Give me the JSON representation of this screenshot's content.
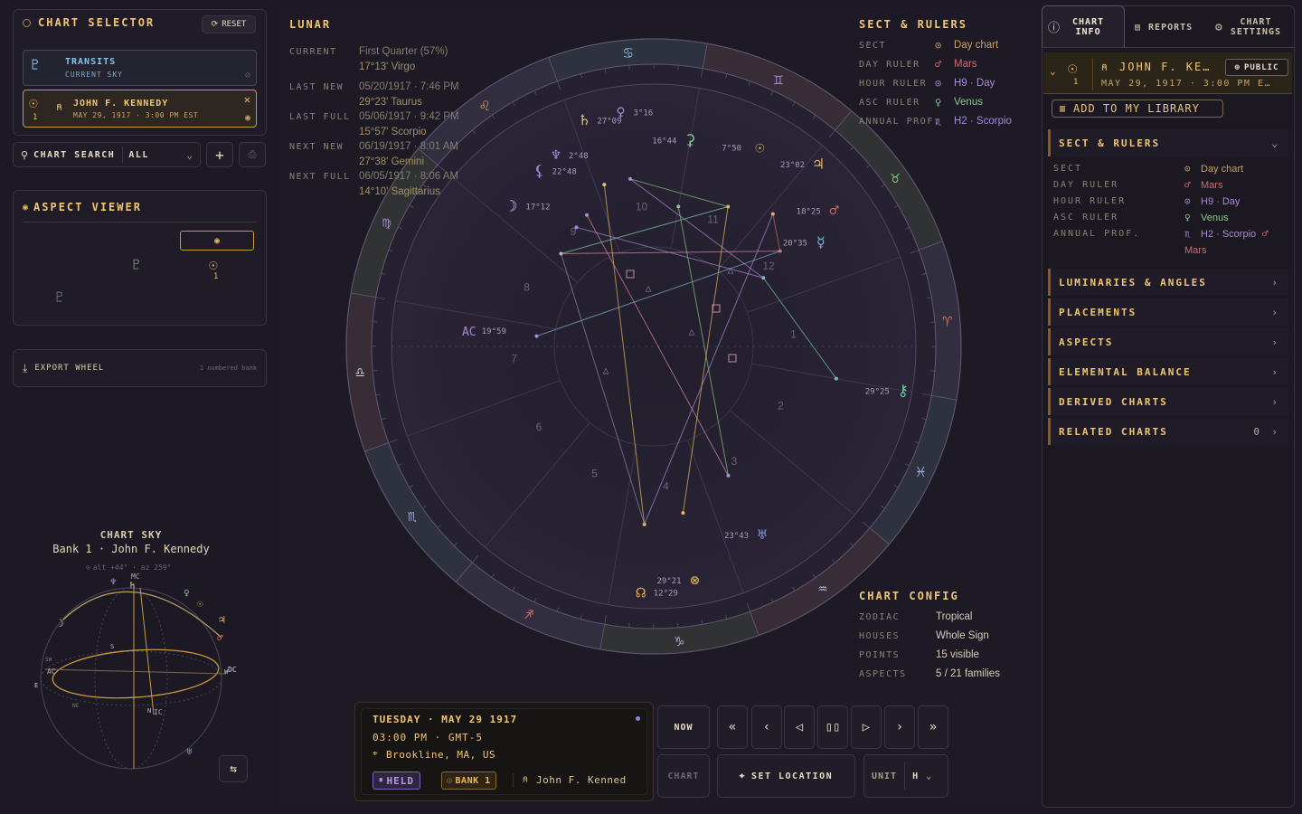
{
  "chart_selector": {
    "title": "CHART SELECTOR",
    "reset": "RESET",
    "transits": {
      "name": "TRANSITS",
      "sub": "CURRENT SKY"
    },
    "kennedy": {
      "name": "JOHN F. KENNEDY",
      "sub": "MAY 29, 1917 · 3:00 PM EST",
      "bank": "1"
    },
    "search_label": "CHART SEARCH",
    "filter": "ALL"
  },
  "aspect_viewer": {
    "title": "ASPECT VIEWER"
  },
  "export": {
    "label": "EXPORT WHEEL",
    "note": "1 numbered bank"
  },
  "sky": {
    "title": "CHART SKY",
    "subtitle": "Bank 1 · John F. Kennedy",
    "readout": "alt +44° · az 259°",
    "horizon": "HORIZON",
    "labels": {
      "mc": "MC",
      "ic": "IC",
      "ac": "AC",
      "dc": "DC",
      "s": "S",
      "n": "N",
      "e": "E",
      "w": "W",
      "sw": "SW",
      "ne": "NE"
    }
  },
  "lunar": {
    "title": "LUNAR",
    "rows": [
      {
        "label": "CURRENT",
        "l1": "First Quarter (57%)",
        "l2": "17°13' Virgo"
      },
      {
        "label": "LAST NEW",
        "l1": "05/20/1917 · 7:46 PM",
        "l2": "29°23' Taurus"
      },
      {
        "label": "LAST FULL",
        "l1": "05/06/1917 · 9:42 PM",
        "l2": "15°57' Scorpio"
      },
      {
        "label": "NEXT NEW",
        "l1": "06/19/1917 · 8:01 AM",
        "l2": "27°38' Gemini"
      },
      {
        "label": "NEXT FULL",
        "l1": "06/05/1917 · 8:06 AM",
        "l2": "14°10' Sagittarius"
      }
    ]
  },
  "sect_rulers": {
    "title": "SECT & RULERS",
    "rows": [
      {
        "label": "SECT",
        "value": "Day chart"
      },
      {
        "label": "DAY RULER",
        "value": "Mars"
      },
      {
        "label": "HOUR RULER",
        "value": "H9 · Day"
      },
      {
        "label": "ASC RULER",
        "value": "Venus"
      },
      {
        "label": "ANNUAL PROF.",
        "value": "H2 · Scorpio"
      }
    ]
  },
  "chart_config": {
    "title": "CHART CONFIG",
    "rows": [
      {
        "label": "ZODIAC",
        "value": "Tropical"
      },
      {
        "label": "HOUSES",
        "value": "Whole Sign"
      },
      {
        "label": "POINTS",
        "value": "15 visible"
      },
      {
        "label": "ASPECTS",
        "value": "5 / 21 families"
      }
    ]
  },
  "wheel": {
    "houses": [
      "1",
      "2",
      "3",
      "4",
      "5",
      "6",
      "7",
      "8",
      "9",
      "10",
      "11",
      "12"
    ],
    "planets": [
      {
        "glyph": "☽",
        "deg": "17°12"
      },
      {
        "glyph": "♆",
        "deg": "2°48"
      },
      {
        "glyph": "♄",
        "deg": "27°09"
      },
      {
        "glyph": "♀",
        "deg": "3°16"
      },
      {
        "glyph": "⚳",
        "deg": "16°44"
      },
      {
        "glyph": "☉",
        "deg": "7°50"
      },
      {
        "glyph": "♃",
        "deg": "23°02"
      },
      {
        "glyph": "♂",
        "deg": "18°25"
      },
      {
        "glyph": "☿",
        "deg": "20°35"
      },
      {
        "glyph": "⚷",
        "deg": "29°25"
      },
      {
        "glyph": "♅",
        "deg": "23°43"
      },
      {
        "glyph": "☊",
        "deg": "12°29"
      },
      {
        "glyph": "⊗",
        "deg": "29°21"
      },
      {
        "glyph": "⚸",
        "deg": "22°48"
      },
      {
        "glyph": "AC",
        "deg": "19°59"
      }
    ]
  },
  "time_panel": {
    "day": "TUESDAY · MAY 29 1917",
    "time": "03:00 PM · GMT-5",
    "place": "Brookline, MA, US",
    "held": "HELD",
    "bank": "BANK 1",
    "person": "John F. Kenned"
  },
  "controls": {
    "now": "NOW",
    "chart": "CHART",
    "set_location": "SET LOCATION",
    "unit": "UNIT",
    "unit_value": "H"
  },
  "right": {
    "tab_info": "CHART\nINFO",
    "tab_reports": "REPORTS",
    "tab_settings": "CHART\nSETTINGS",
    "name": "JOHN F. KE…",
    "public": "PUBLIC",
    "date": "MAY 29, 1917 · 3:00 PM E…",
    "bank": "1",
    "add_library": "ADD TO MY LIBRARY",
    "sect_title": "SECT & RULERS",
    "sect_rows": [
      {
        "label": "SECT",
        "value": "Day chart"
      },
      {
        "label": "DAY RULER",
        "value": "Mars"
      },
      {
        "label": "HOUR RULER",
        "value": "H9 · Day"
      },
      {
        "label": "ASC RULER",
        "value": "Venus"
      },
      {
        "label": "ANNUAL PROF.",
        "value": "H2 · Scorpio",
        "extra": "Mars"
      }
    ],
    "sections": [
      "LUMINARIES & ANGLES",
      "PLACEMENTS",
      "ASPECTS",
      "ELEMENTAL BALANCE",
      "DERIVED CHARTS",
      "RELATED CHARTS"
    ],
    "related_count": "0"
  }
}
